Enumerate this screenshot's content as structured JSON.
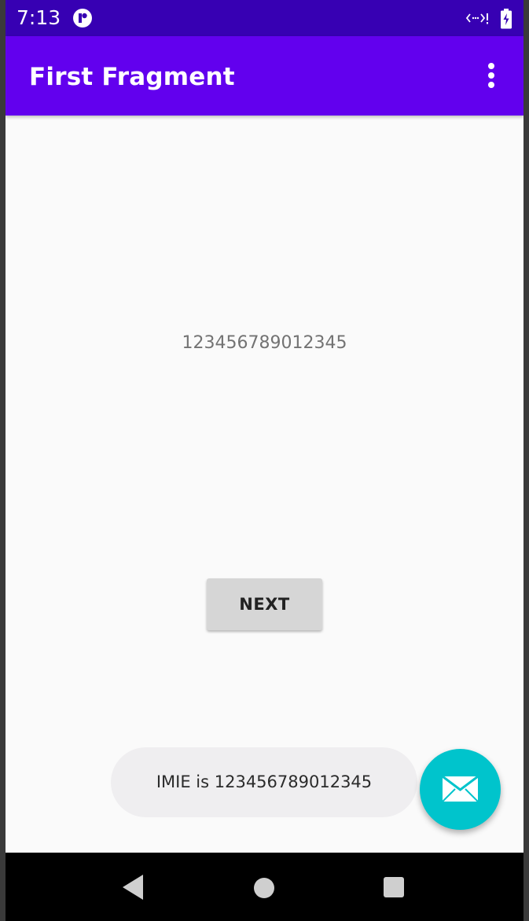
{
  "status_bar": {
    "time": "7:13",
    "app_icon": "app-notification-icon",
    "network_icon": "no-network-icon",
    "battery_icon": "battery-charging-icon"
  },
  "app_bar": {
    "title": "First Fragment",
    "menu_icon": "more-vert-icon"
  },
  "content": {
    "imei_value": "123456789012345",
    "next_button_label": "NEXT"
  },
  "toast": {
    "message": "IMIE is 123456789012345"
  },
  "fab": {
    "icon": "mail-icon"
  },
  "nav_bar": {
    "back_icon": "back-triangle-icon",
    "home_icon": "home-circle-icon",
    "recents_icon": "recents-square-icon"
  },
  "colors": {
    "status_bar": "#3700b3",
    "app_bar": "#6200ee",
    "fab": "#00c4cc",
    "background": "#fafafa",
    "button": "#d6d6d6",
    "toast": "#efeef0"
  }
}
